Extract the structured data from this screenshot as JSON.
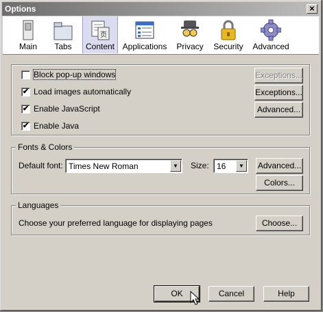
{
  "window": {
    "title": "Options",
    "close_glyph": "✕"
  },
  "toolbar": {
    "items": [
      {
        "label": "Main",
        "icon": "main-switch-icon"
      },
      {
        "label": "Tabs",
        "icon": "tabs-folder-icon"
      },
      {
        "label": "Content",
        "icon": "content-page-icon",
        "selected": true
      },
      {
        "label": "Applications",
        "icon": "applications-list-icon"
      },
      {
        "label": "Privacy",
        "icon": "privacy-mask-icon"
      },
      {
        "label": "Security",
        "icon": "security-lock-icon"
      },
      {
        "label": "Advanced",
        "icon": "advanced-gear-icon"
      }
    ]
  },
  "content": {
    "block_popups": {
      "label": "Block pop-up windows",
      "checked": false
    },
    "load_images": {
      "label": "Load images automatically",
      "checked": true
    },
    "enable_js": {
      "label": "Enable JavaScript",
      "checked": true
    },
    "enable_java": {
      "label": "Enable Java",
      "checked": true
    },
    "exceptions_disabled": "Exceptions...",
    "exceptions": "Exceptions...",
    "advanced": "Advanced..."
  },
  "fonts": {
    "legend": "Fonts & Colors",
    "default_font_label": "Default font:",
    "default_font_value": "Times New Roman",
    "size_label": "Size:",
    "size_value": "16",
    "advanced": "Advanced...",
    "colors": "Colors..."
  },
  "languages": {
    "legend": "Languages",
    "description": "Choose your preferred language for displaying pages",
    "choose": "Choose..."
  },
  "buttons": {
    "ok": "OK",
    "cancel": "Cancel",
    "help": "Help"
  },
  "check_glyph": "✔"
}
